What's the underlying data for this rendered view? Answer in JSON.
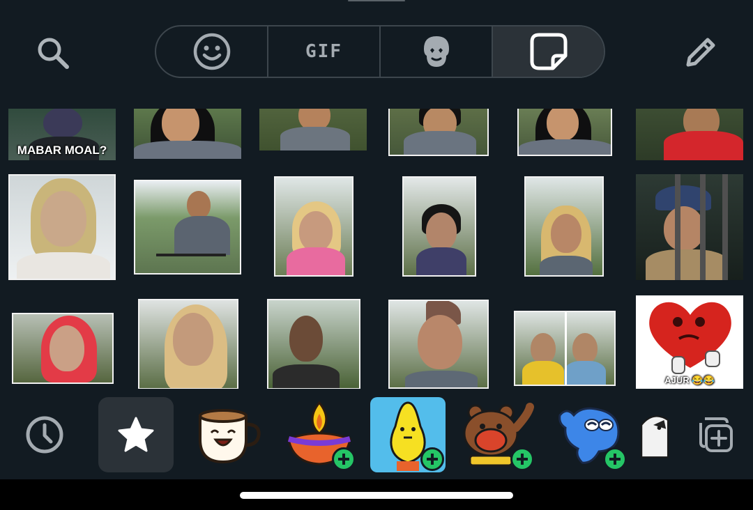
{
  "top_bar": {
    "search_icon": "search-icon",
    "tabs": [
      {
        "name": "emoji",
        "icon": "smiley-icon"
      },
      {
        "name": "gif",
        "label": "GIF"
      },
      {
        "name": "avatar",
        "icon": "avatar-icon"
      },
      {
        "name": "stickers",
        "icon": "sticker-icon",
        "active": true
      }
    ],
    "edit_icon": "pencil-icon"
  },
  "stickers": {
    "row1": [
      {
        "caption": "MABAR MOAL?"
      },
      {
        "caption": ""
      },
      {
        "caption": ""
      },
      {
        "caption": ""
      },
      {
        "caption": ""
      },
      {
        "caption": ""
      }
    ],
    "row3_last_caption": "AJUR 😂😂"
  },
  "tray": {
    "recent_icon": "clock-icon",
    "favorites_icon": "star-icon",
    "packs": [
      "coffee-cup-pack",
      "diwali-lamp-pack",
      "pear-character-pack",
      "bear-pack",
      "blue-ghost-pack",
      "penguin-pack"
    ],
    "add_pack_icon": "add-sticker-pack-icon"
  },
  "colors": {
    "background": "#121b22",
    "active_tab": "#2b3238",
    "add_badge": "#25c566",
    "selected_pack": "#53bdeb"
  }
}
